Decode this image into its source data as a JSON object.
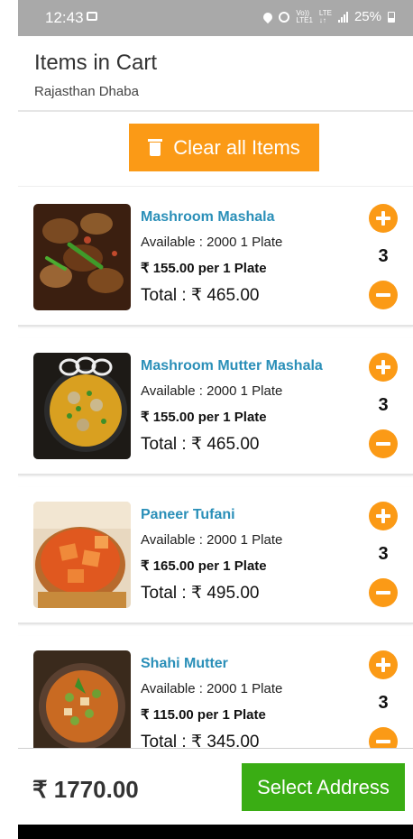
{
  "status_bar": {
    "time": "12:43",
    "network_top": "Vo))",
    "network_bottom": "LTE1",
    "lte_top": "LTE",
    "lte_bottom": "↓↑",
    "battery": "25%"
  },
  "header": {
    "title": "Items in Cart",
    "restaurant": "Rajasthan Dhaba"
  },
  "clear_button_label": "Clear all Items",
  "items": [
    {
      "name": "Mashroom Mashala",
      "available": "Available : 2000 1 Plate",
      "price": "₹ 155.00 per 1 Plate",
      "total": "Total : ₹ 465.00",
      "quantity": "3",
      "image": "mushroom-curry-photo"
    },
    {
      "name": "Mashroom Mutter Mashala",
      "available": "Available : 2000 1 Plate",
      "price": "₹ 155.00 per 1 Plate",
      "total": "Total : ₹ 465.00",
      "quantity": "3",
      "image": "mushroom-peas-curry-photo"
    },
    {
      "name": "Paneer Tufani",
      "available": "Available : 2000 1 Plate",
      "price": "₹ 165.00 per 1 Plate",
      "total": "Total : ₹ 495.00",
      "quantity": "3",
      "image": "paneer-curry-photo"
    },
    {
      "name": "Shahi Mutter",
      "available": "Available : 2000 1 Plate",
      "price": "₹ 115.00 per 1 Plate",
      "total": "Total : ₹ 345.00",
      "quantity": "3",
      "image": "peas-curry-photo"
    }
  ],
  "footer": {
    "total_amount": "₹ 1770.00",
    "select_address_label": "Select Address"
  },
  "colors": {
    "accent_orange": "#fb9a16",
    "item_name_blue": "#2a8fb8",
    "button_green": "#3aad14",
    "status_bar_gray": "#a9a9a9"
  }
}
